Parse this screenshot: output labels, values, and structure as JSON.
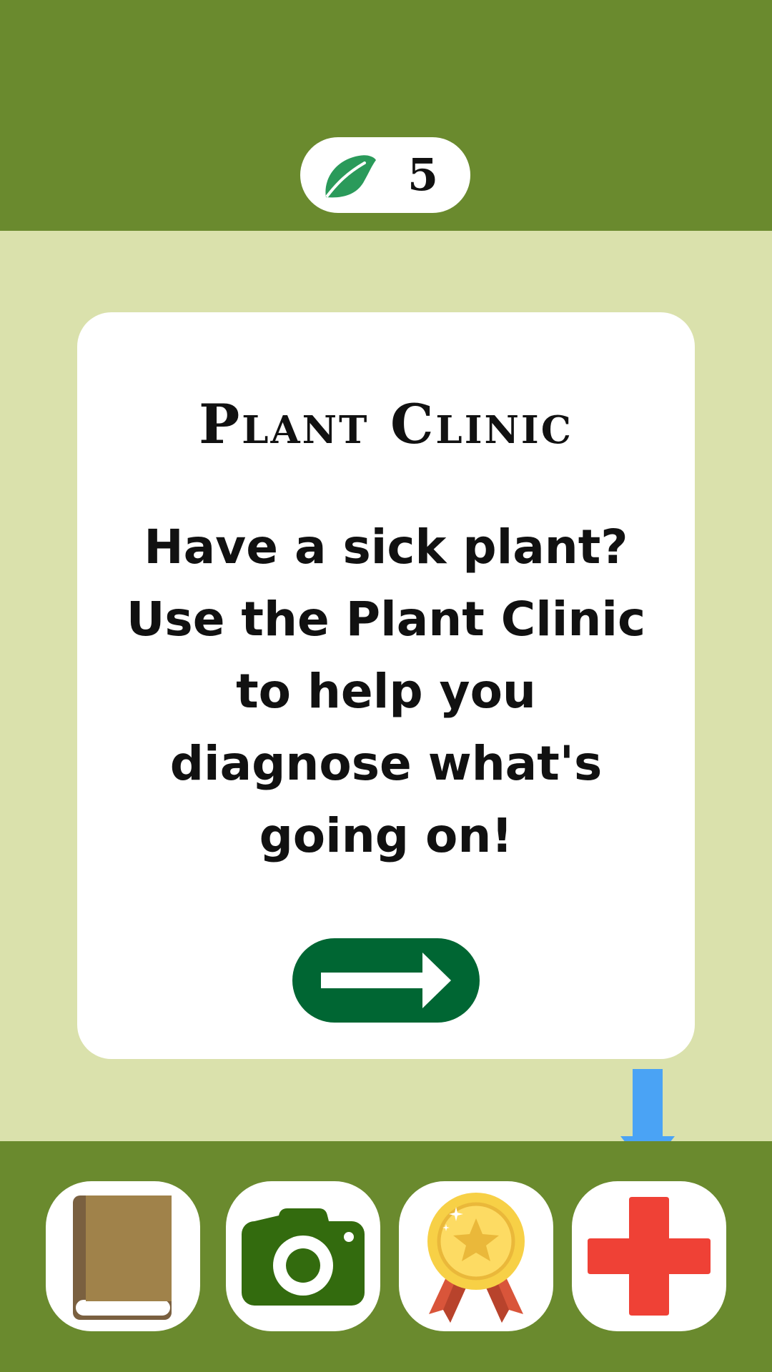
{
  "header": {
    "leaf_icon": "leaf-icon",
    "leaf_count": "5"
  },
  "card": {
    "title": "Plant Clinic",
    "description": "Have a sick plant?\nUse the Plant Clinic\nto help you\ndiagnose what's\ngoing on!",
    "next_icon": "right-arrow-icon"
  },
  "nav": {
    "items": [
      {
        "icon": "book-icon"
      },
      {
        "icon": "camera-icon"
      },
      {
        "icon": "medal-icon"
      },
      {
        "icon": "red-cross-icon"
      }
    ],
    "pointer_icon": "down-arrow-icon"
  },
  "colors": {
    "bar_green": "#6a8a2e",
    "background": "#dae1ac",
    "button_green": "#006633",
    "pointer_blue": "#4aa3f5",
    "cross_red": "#ef4136"
  }
}
